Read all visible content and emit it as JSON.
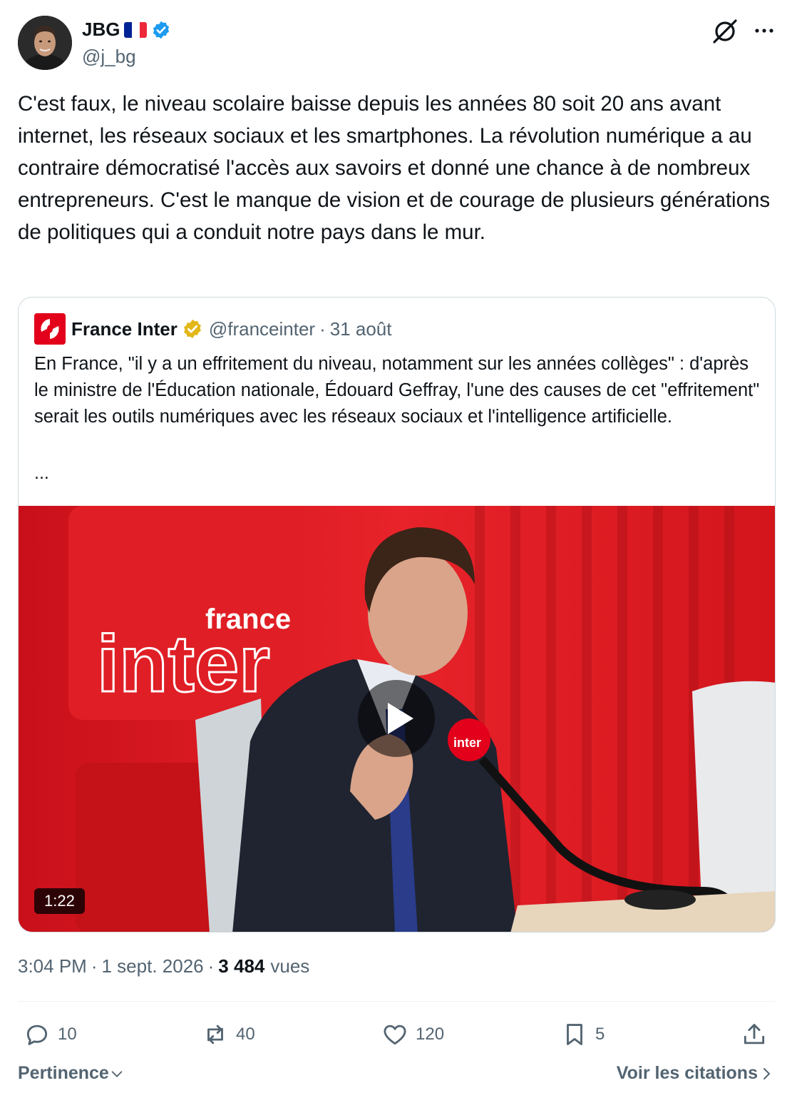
{
  "author": {
    "display_name": "JBG",
    "handle": "@j_bg",
    "flag_colors": [
      "#002395",
      "#ffffff",
      "#ed2939"
    ],
    "verified_color": "#1d9bf0"
  },
  "icons": {
    "grok": "grok-icon",
    "more": "more-icon",
    "reply": "reply-icon",
    "retweet": "retweet-icon",
    "like": "heart-icon",
    "bookmark": "bookmark-icon",
    "share": "share-icon"
  },
  "tweet": {
    "text": "C'est faux, le niveau scolaire baisse depuis les années 80 soit 20 ans avant internet, les réseaux sociaux et les smartphones. La révolution numérique a au contraire démocratisé l'accès aux savoirs et donné une chance à de nombreux entrepreneurs. C'est le manque de vision et de courage de plusieurs générations de politiques qui a conduit notre pays dans le mur."
  },
  "quote": {
    "name": "France Inter",
    "handle": "@franceinter",
    "separator": "·",
    "date": "31 août",
    "verified_color": "#e2b719",
    "logo_color": "#e2001a",
    "text": "En France, \"il y a un effritement du niveau, notamment sur les années collèges\" : d'après le ministre de l'Éducation nationale, Édouard Geffray, l'une des causes de cet \"effritement\" serait les outils numériques avec les réseaux sociaux et l'intelligence artificielle.",
    "ellipsis": "...",
    "video": {
      "logo_line1": "france",
      "logo_line2": "inter",
      "mic_label": "inter",
      "duration": "1:22"
    }
  },
  "meta": {
    "time": "3:04 PM",
    "sep": "·",
    "date": "1 sept. 2026",
    "views_count": "3 484",
    "views_label": "vues"
  },
  "actions": {
    "replies": "10",
    "retweets": "40",
    "likes": "120",
    "bookmarks": "5"
  },
  "footer": {
    "sort_label": "Pertinence",
    "quotes_label": "Voir les citations"
  },
  "colors": {
    "text": "#0f1419",
    "secondary": "#536471",
    "border": "#cfd9de",
    "studio_red": "#d8141a"
  }
}
